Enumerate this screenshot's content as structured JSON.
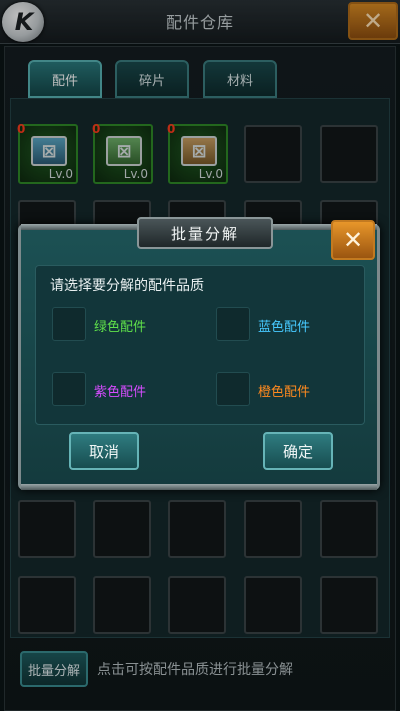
{
  "header": {
    "title": "配件仓库",
    "logo_letter": "K",
    "close_glyph": "✕"
  },
  "tabs": [
    {
      "label": "配件",
      "active": true
    },
    {
      "label": "碎片",
      "active": false
    },
    {
      "label": "材料",
      "active": false
    }
  ],
  "items": [
    {
      "count": "0",
      "level": "Lv.0",
      "color": "blue"
    },
    {
      "count": "0",
      "level": "Lv.0",
      "color": "green"
    },
    {
      "count": "0",
      "level": "Lv.0",
      "color": "orange"
    }
  ],
  "bottom": {
    "button": "批量分解",
    "hint": "点击可按配件品质进行批量分解"
  },
  "dialog": {
    "title": "批量分解",
    "close_glyph": "✕",
    "prompt": "请选择要分解的配件品质",
    "qualities": [
      {
        "label": "绿色配件",
        "color": "#5fe04a"
      },
      {
        "label": "蓝色配件",
        "color": "#47c9ff"
      },
      {
        "label": "紫色配件",
        "color": "#d64cff"
      },
      {
        "label": "橙色配件",
        "color": "#ff8a1f"
      }
    ],
    "cancel": "取消",
    "confirm": "确定"
  },
  "colors": {
    "accent": "#2a7a7d",
    "close": "#e7962a",
    "count": "#ff3b1e"
  }
}
